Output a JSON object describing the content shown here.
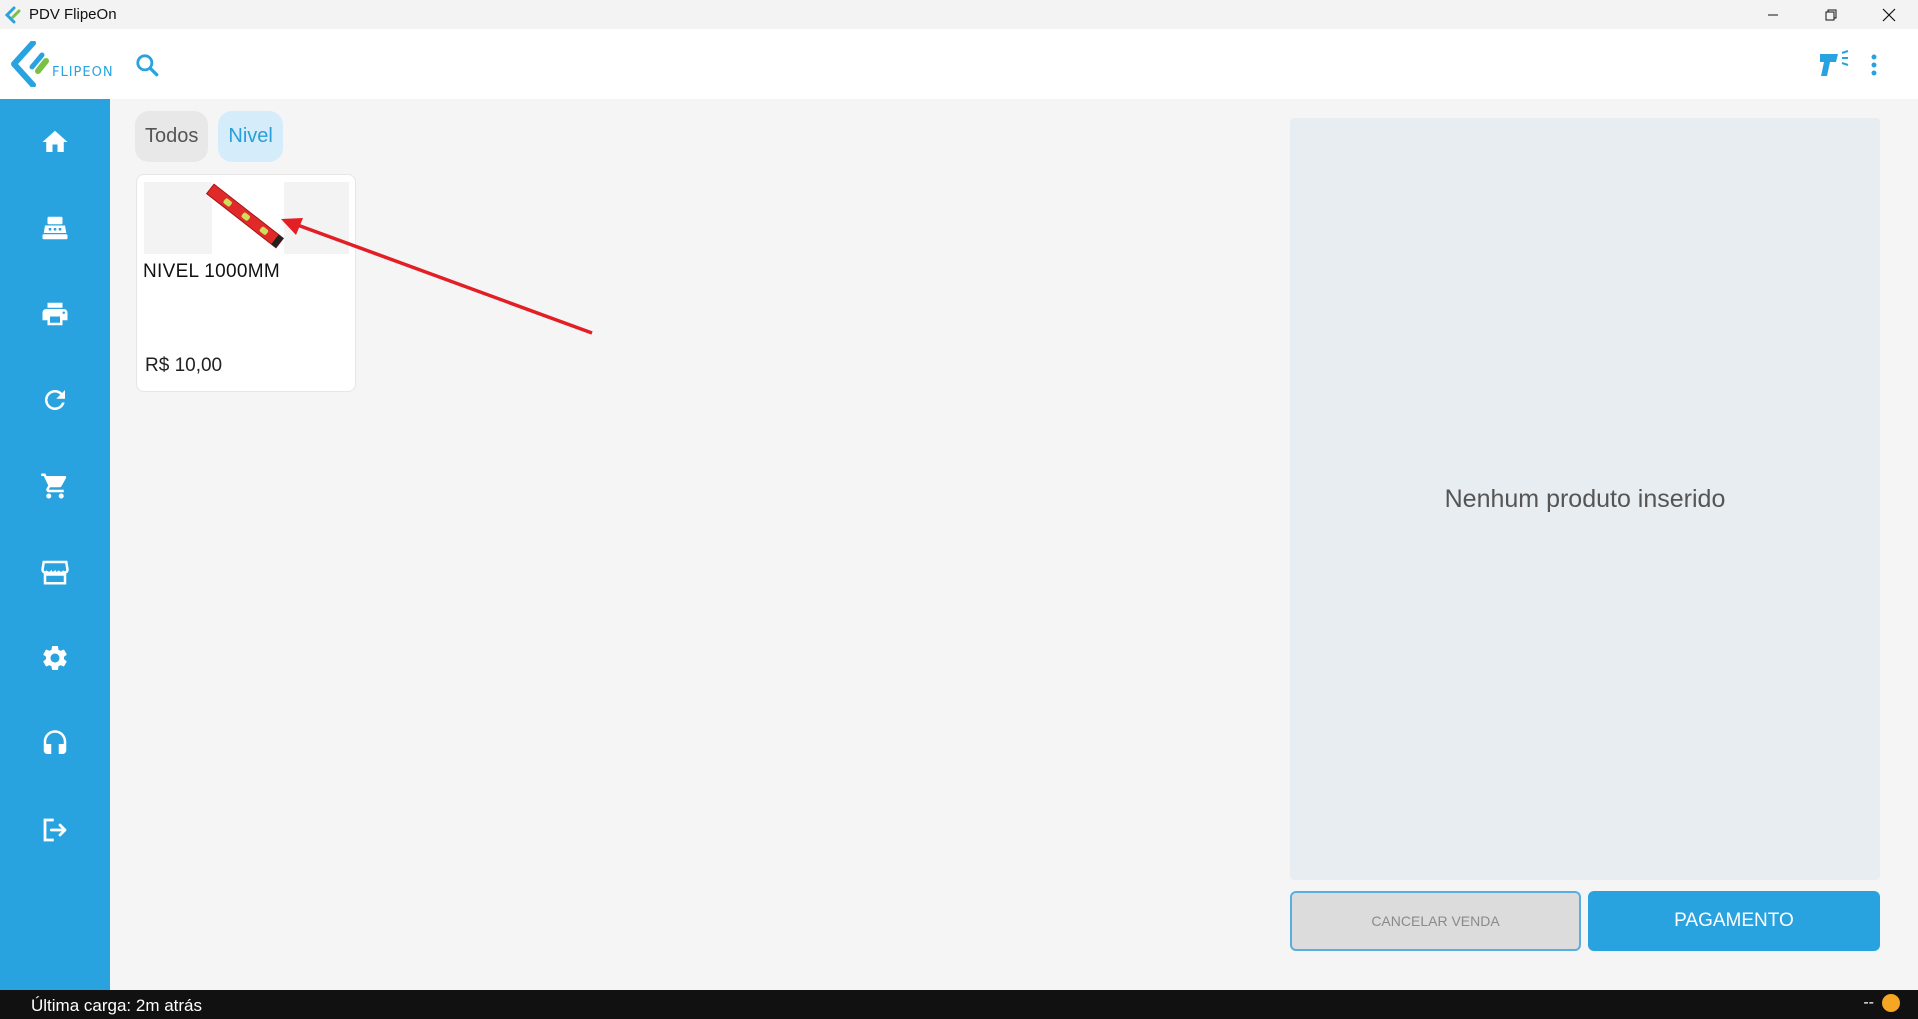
{
  "window": {
    "title": "PDV FlipeOn",
    "controls": [
      "minimize-icon",
      "restore-icon",
      "close-icon"
    ]
  },
  "header": {
    "logo_text": "FLIPEON",
    "search_icon": "search-icon",
    "scanner_icon": "barcode-scanner-icon",
    "menu_icon": "more-vert-icon"
  },
  "sidebar": {
    "items": [
      {
        "name": "home",
        "icon": "home-icon"
      },
      {
        "name": "cash-register",
        "icon": "cash-register-icon"
      },
      {
        "name": "print",
        "icon": "printer-icon"
      },
      {
        "name": "sync",
        "icon": "refresh-icon"
      },
      {
        "name": "cart",
        "icon": "cart-icon"
      },
      {
        "name": "store",
        "icon": "storefront-icon"
      },
      {
        "name": "settings",
        "icon": "gear-icon"
      },
      {
        "name": "support",
        "icon": "headset-icon"
      },
      {
        "name": "logout",
        "icon": "logout-icon"
      }
    ]
  },
  "categories": {
    "all_label": "Todos",
    "active_label": "Nivel"
  },
  "products": [
    {
      "name": "NIVEL 1000MM",
      "price": "R$ 10,00"
    }
  ],
  "cart": {
    "empty_text": "Nenhum produto inserido",
    "cancel_label": "CANCELAR VENDA",
    "pay_label": "PAGAMENTO"
  },
  "status": {
    "last_load": "Última carga: 2m atrás",
    "right_text": "--",
    "indicator_color": "#f5a623"
  },
  "colors": {
    "accent": "#29a3e0",
    "annotation": "#e31e24"
  }
}
